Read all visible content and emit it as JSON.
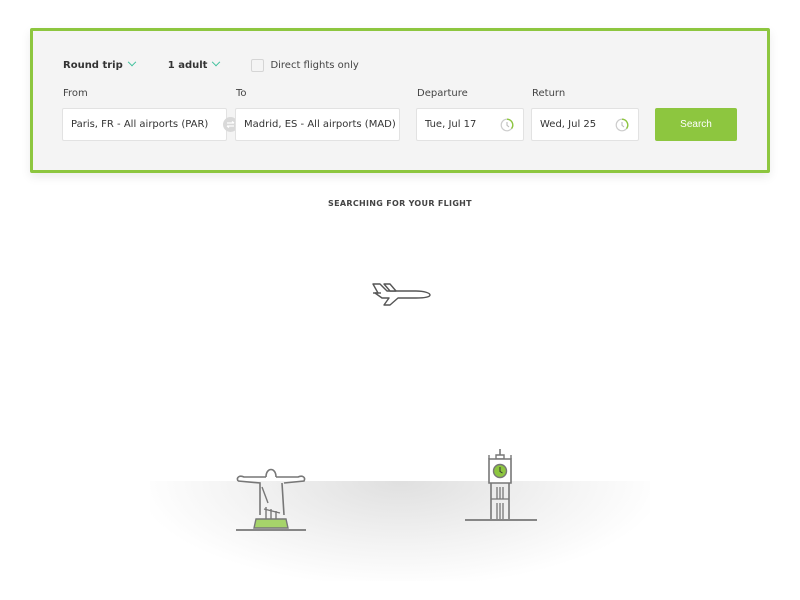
{
  "search_form": {
    "trip_type": "Round trip",
    "passengers": "1 adult",
    "direct_flights_label": "Direct flights only",
    "direct_flights_checked": false,
    "from_label": "From",
    "from_value": "Paris, FR - All airports (PAR)",
    "to_label": "To",
    "to_value": "Madrid, ES - All airports (MAD)",
    "departure_label": "Departure",
    "departure_value": "Tue, Jul 17",
    "return_label": "Return",
    "return_value": "Wed, Jul 25",
    "search_label": "Search"
  },
  "status": {
    "message": "SEARCHING FOR YOUR FLIGHT"
  },
  "illustration": {
    "icons": [
      "airplane-icon",
      "christ-the-redeemer-icon",
      "big-ben-icon"
    ]
  },
  "colors": {
    "accent": "#8dc63f",
    "chevron": "#3cbf9a",
    "panel_bg": "#f4f4f4"
  }
}
